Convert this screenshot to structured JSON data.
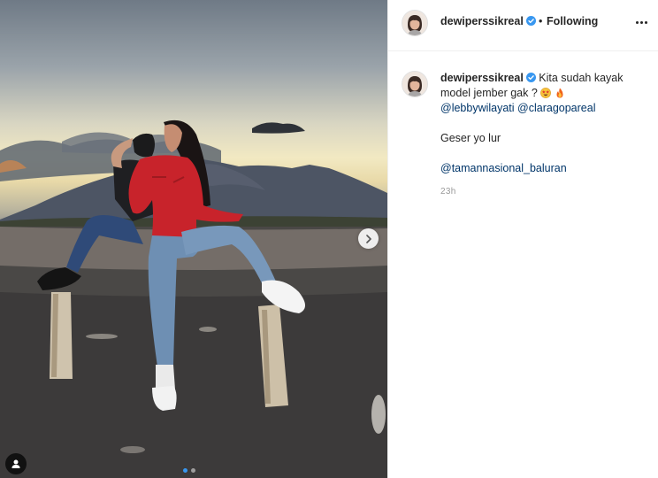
{
  "post": {
    "username": "dewiperssikreal",
    "verified": true,
    "separator": "•",
    "follow_status": "Following",
    "more_options_icon": "more-horizontal-icon",
    "caption": {
      "line1_text": "Kita sudah kayak",
      "line2_text": "model jember gak ?",
      "emojis": [
        "star-struck-face",
        "fire"
      ],
      "mention_1": "@lebbywilayati",
      "mention_2": "@claragopareal",
      "line3": "Geser yo lur",
      "location_tag": "@tamannasional_baluran"
    },
    "timestamp": "23h"
  },
  "media": {
    "carousel_current": 1,
    "carousel_total": 2,
    "next_icon": "chevron-right-icon",
    "tag_icon": "user-tag-icon"
  },
  "colors": {
    "text": "#262626",
    "link": "#003569",
    "muted": "#999999",
    "verified": "#3897f0",
    "border": "#efefef"
  }
}
